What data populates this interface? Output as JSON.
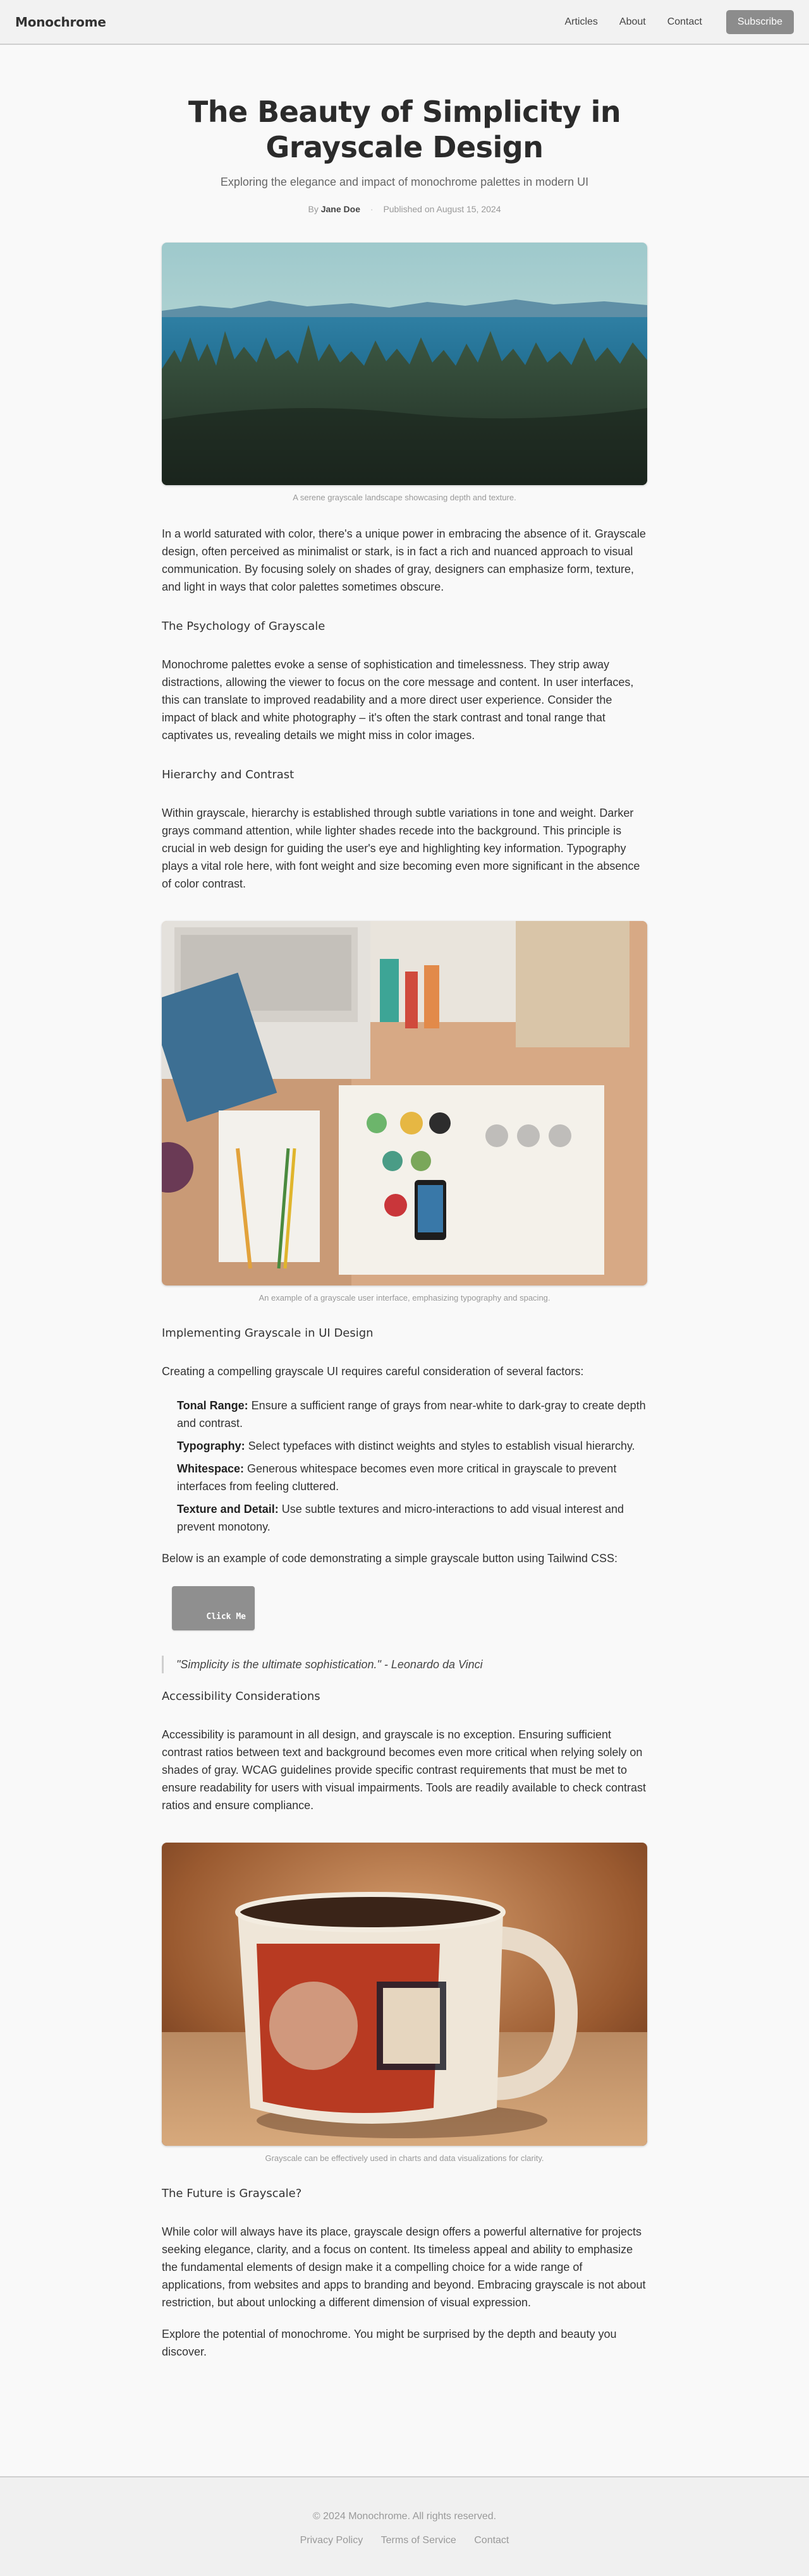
{
  "header": {
    "brand": "Monochrome",
    "nav": [
      "Articles",
      "About",
      "Contact"
    ],
    "subscribe_label": "Subscribe"
  },
  "article": {
    "title": "The Beauty of Simplicity in Grayscale Design",
    "subtitle": "Exploring the elegance and impact of monochrome palettes in modern UI",
    "by_prefix": "By",
    "author": "Jane Doe",
    "separator": "·",
    "published": "Published on August 15, 2024",
    "figures": [
      {
        "caption": "A serene grayscale landscape showcasing depth and texture."
      },
      {
        "caption": "An example of a grayscale user interface, emphasizing typography and spacing."
      },
      {
        "caption": "Grayscale can be effectively used in charts and data visualizations for clarity."
      }
    ],
    "intro": "In a world saturated with color, there's a unique power in embracing the absence of it. Grayscale design, often perceived as minimalist or stark, is in fact a rich and nuanced approach to visual communication. By focusing solely on shades of gray, designers can emphasize form, texture, and light in ways that color palettes sometimes obscure.",
    "sections": [
      {
        "heading": "The Psychology of Grayscale",
        "text": "Monochrome palettes evoke a sense of sophistication and timelessness. They strip away distractions, allowing the viewer to focus on the core message and content. In user interfaces, this can translate to improved readability and a more direct user experience. Consider the impact of black and white photography – it's often the stark contrast and tonal range that captivates us, revealing details we might miss in color images."
      },
      {
        "heading": "Hierarchy and Contrast",
        "text": "Within grayscale, hierarchy is established through subtle variations in tone and weight. Darker grays command attention, while lighter shades recede into the background. This principle is crucial in web design for guiding the user's eye and highlighting key information. Typography plays a vital role here, with font weight and size becoming even more significant in the absence of color contrast."
      },
      {
        "heading": "Implementing Grayscale in UI Design",
        "text": "Creating a compelling grayscale UI requires careful consideration of several factors:"
      },
      {
        "heading": "Accessibility Considerations",
        "text": "Accessibility is paramount in all design, and grayscale is no exception. Ensuring sufficient contrast ratios between text and background becomes even more critical when relying solely on shades of gray. WCAG guidelines provide specific contrast requirements that must be met to ensure readability for users with visual impairments. Tools are readily available to check contrast ratios and ensure compliance."
      },
      {
        "heading": "The Future is Grayscale?",
        "text": "While color will always have its place, grayscale design offers a powerful alternative for projects seeking elegance, clarity, and a focus on content. Its timeless appeal and ability to emphasize the fundamental elements of design make it a compelling choice for a wide range of applications, from websites and apps to branding and beyond. Embracing grayscale is not about restriction, but about unlocking a different dimension of visual expression."
      }
    ],
    "factors": [
      {
        "term": "Tonal Range:",
        "desc": " Ensure a sufficient range of grays from near-white to dark-gray to create depth and contrast."
      },
      {
        "term": "Typography:",
        "desc": " Select typefaces with distinct weights and styles to establish visual hierarchy."
      },
      {
        "term": "Whitespace:",
        "desc": " Generous whitespace becomes even more critical in grayscale to prevent interfaces from feeling cluttered."
      },
      {
        "term": "Texture and Detail:",
        "desc": " Use subtle textures and micro-interactions to add visual interest and prevent monotony."
      }
    ],
    "code_intro": "Below is an example of code demonstrating a simple grayscale button using Tailwind CSS:",
    "code_button_label": "Click Me",
    "quote": "\"Simplicity is the ultimate sophistication.\" - Leonardo da Vinci",
    "closing": "Explore the potential of monochrome. You might be surprised by the depth and beauty you discover."
  },
  "footer": {
    "copyright": "© 2024 Monochrome. All rights reserved.",
    "links": [
      "Privacy Policy",
      "Terms of Service",
      "Contact"
    ]
  },
  "colors": {
    "page_bg": "#f9f9f9",
    "header_bg": "#f2f2f2",
    "button_gray": "#8c8c8c",
    "text": "#333333",
    "muted": "#999999"
  }
}
